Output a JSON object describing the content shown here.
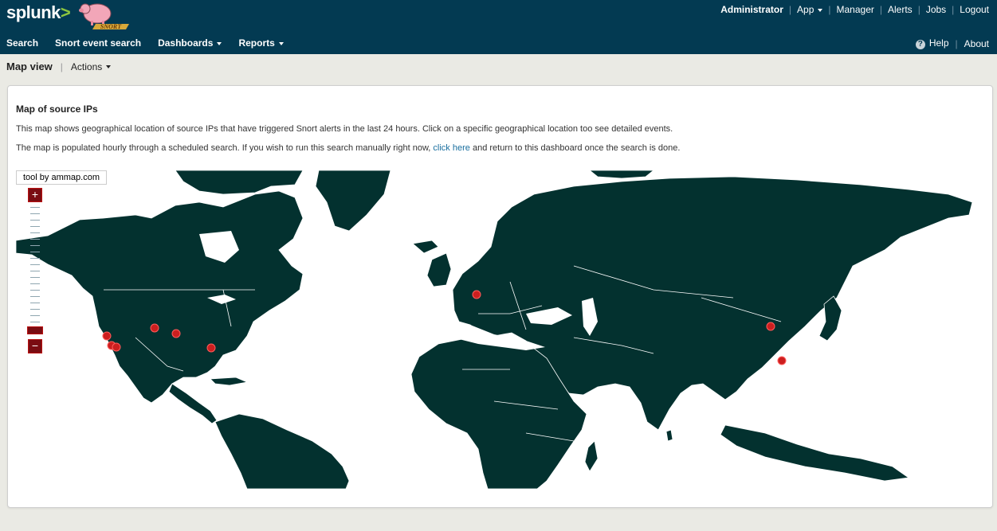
{
  "header": {
    "logo_text": "splunk",
    "logo_chevron": ">",
    "app_logo_text": "SNORT",
    "top_links": {
      "user": "Administrator",
      "app": "App",
      "manager": "Manager",
      "alerts": "Alerts",
      "jobs": "Jobs",
      "logout": "Logout"
    },
    "nav": {
      "search": "Search",
      "snort_event_search": "Snort event search",
      "dashboards": "Dashboards",
      "reports": "Reports"
    },
    "help": "Help",
    "about": "About"
  },
  "action_bar": {
    "view_title": "Map view",
    "actions": "Actions"
  },
  "panel": {
    "title": "Map of source IPs",
    "description": "This map shows geographical location of source IPs that have triggered Snort alerts in the last 24 hours. Click on a specific geographical location too see detailed events.",
    "note_before_link": "The map is populated hourly through a scheduled search. If you wish to run this search manually right now,",
    "link_text": "click here",
    "note_after_link": "and return to this dashboard once the search is done."
  },
  "map": {
    "credit": "tool by ammap.com",
    "zoom_in": "+",
    "zoom_out": "−",
    "colors": {
      "land": "#03312f",
      "marker": "#cc1f1f",
      "water": "#ffffff"
    }
  }
}
